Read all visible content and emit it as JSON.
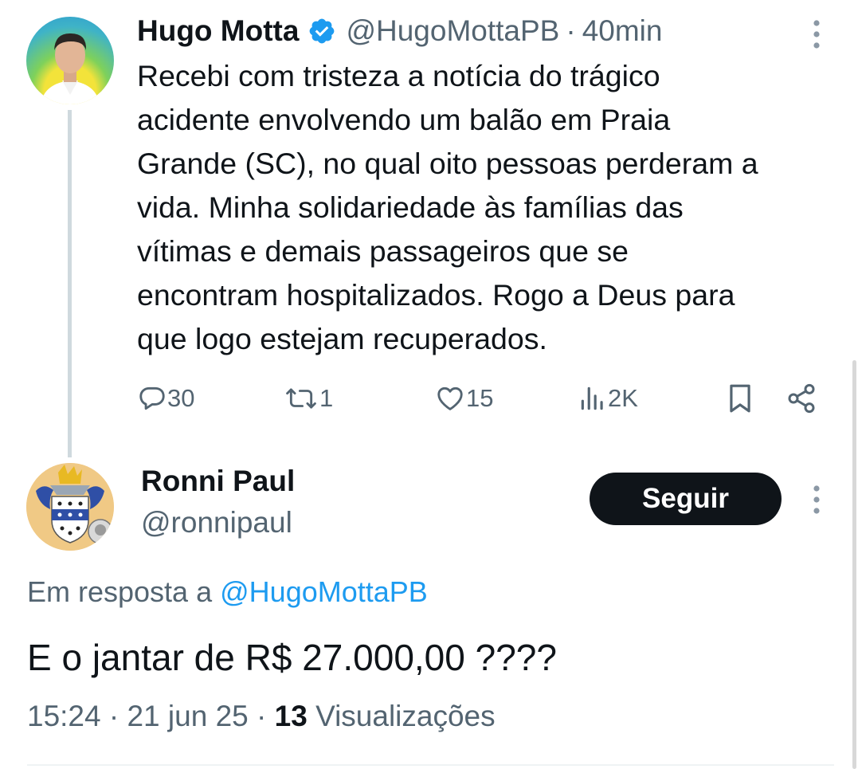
{
  "tweet": {
    "author_name": "Hugo Motta",
    "author_handle": "@HugoMottaPB",
    "separator": "·",
    "time_ago": "40min",
    "text_lines": [
      "Recebi com tristeza a notícia do trágico",
      "acidente envolvendo um balão em Praia",
      "Grande (SC), no qual oito pessoas perderam a",
      "vida. Minha solidariedade às famílias das",
      "vítimas e demais passageiros que se",
      "encontram hospitalizados. Rogo a Deus para",
      "que logo estejam recuperados."
    ],
    "stats": {
      "replies": "30",
      "retweets": "1",
      "likes": "15",
      "views": "2K"
    }
  },
  "reply": {
    "author_name": "Ronni Paul",
    "author_handle": "@ronnipaul",
    "follow_label": "Seguir",
    "reply_to_prefix": "Em resposta a",
    "reply_to_handle": "@HugoMottaPB",
    "text": "E o jantar de R$ 27.000,00 ????",
    "time": "15:24",
    "date": "21 jun 25",
    "views_count": "13",
    "views_label": "Visualizações"
  },
  "colors": {
    "accent": "#1d9bf0",
    "text_primary": "#0f1419",
    "text_secondary": "#536471",
    "follow_button": "#0f1419"
  },
  "icons": [
    "verified-badge-icon",
    "more-icon",
    "reply-icon",
    "retweet-icon",
    "like-icon",
    "views-icon",
    "bookmark-icon",
    "share-icon"
  ]
}
